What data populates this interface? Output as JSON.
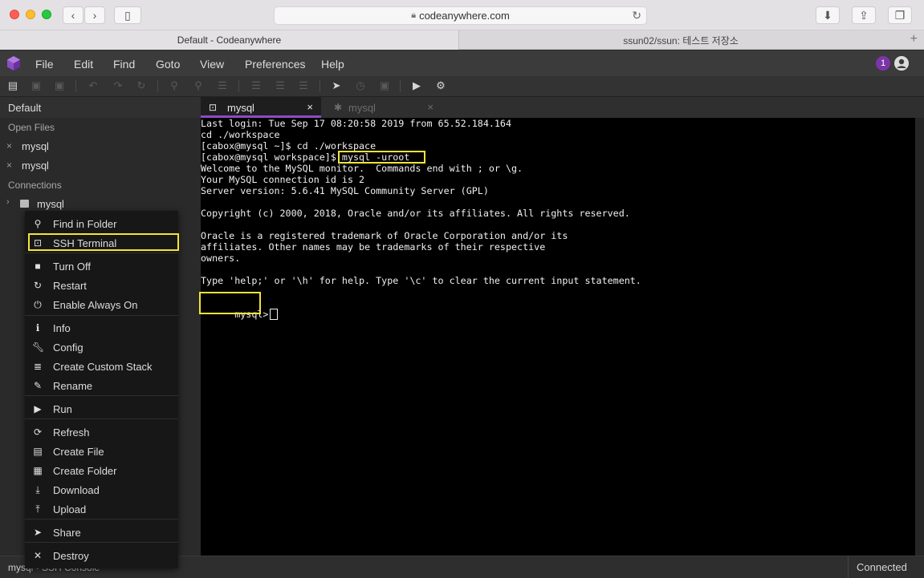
{
  "browser": {
    "url": "codeanywhere.com",
    "tabs": [
      {
        "title": "Default - Codeanywhere",
        "active": true
      },
      {
        "title": "ssun02/ssun: 테스트 저장소",
        "active": false
      }
    ]
  },
  "menu": {
    "items": [
      "File",
      "Edit",
      "Find",
      "Goto",
      "View",
      "Preferences",
      "Help"
    ],
    "notification_count": "1"
  },
  "sidebar": {
    "project": "Default",
    "open_files_label": "Open Files",
    "open_files": [
      "mysql",
      "mysql"
    ],
    "connections_label": "Connections",
    "connection": "mysql"
  },
  "context_menu": {
    "items": [
      {
        "icon": "search-icon",
        "label": "Find in Folder"
      },
      {
        "icon": "terminal-icon",
        "label": "SSH Terminal",
        "highlighted": true
      },
      {
        "icon": "stop-icon",
        "label": "Turn Off"
      },
      {
        "icon": "restart-icon",
        "label": "Restart"
      },
      {
        "icon": "power-icon",
        "label": "Enable Always On"
      },
      {
        "icon": "info-icon",
        "label": "Info"
      },
      {
        "icon": "wrench-icon",
        "label": "Config"
      },
      {
        "icon": "stack-icon",
        "label": "Create Custom Stack"
      },
      {
        "icon": "pencil-icon",
        "label": "Rename"
      },
      {
        "icon": "play-icon",
        "label": "Run"
      },
      {
        "icon": "refresh-icon",
        "label": "Refresh"
      },
      {
        "icon": "new-file-icon",
        "label": "Create File"
      },
      {
        "icon": "new-folder-icon",
        "label": "Create Folder"
      },
      {
        "icon": "download-icon",
        "label": "Download"
      },
      {
        "icon": "upload-icon",
        "label": "Upload"
      },
      {
        "icon": "share-icon",
        "label": "Share"
      },
      {
        "icon": "close-icon",
        "label": "Destroy"
      }
    ]
  },
  "editor": {
    "tabs": [
      {
        "label": "mysql",
        "active": true
      },
      {
        "label": "mysql",
        "active": false
      }
    ]
  },
  "terminal": {
    "lines": [
      "Last login: Tue Sep 17 08:20:58 2019 from 65.52.184.164",
      "cd ./workspace",
      "[cabox@mysql ~]$ cd ./workspace",
      "[cabox@mysql workspace]$ mysql -uroot",
      "Welcome to the MySQL monitor.  Commands end with ; or \\g.",
      "Your MySQL connection id is 2",
      "Server version: 5.6.41 MySQL Community Server (GPL)",
      "",
      "Copyright (c) 2000, 2018, Oracle and/or its affiliates. All rights reserved.",
      "",
      "Oracle is a registered trademark of Oracle Corporation and/or its",
      "affiliates. Other names may be trademarks of their respective",
      "owners.",
      "",
      "Type 'help;' or '\\h' for help. Type '\\c' to clear the current input statement.",
      ""
    ],
    "prompt": "mysql>"
  },
  "status": {
    "left": "mysql - SSH Console",
    "right": "Connected"
  }
}
